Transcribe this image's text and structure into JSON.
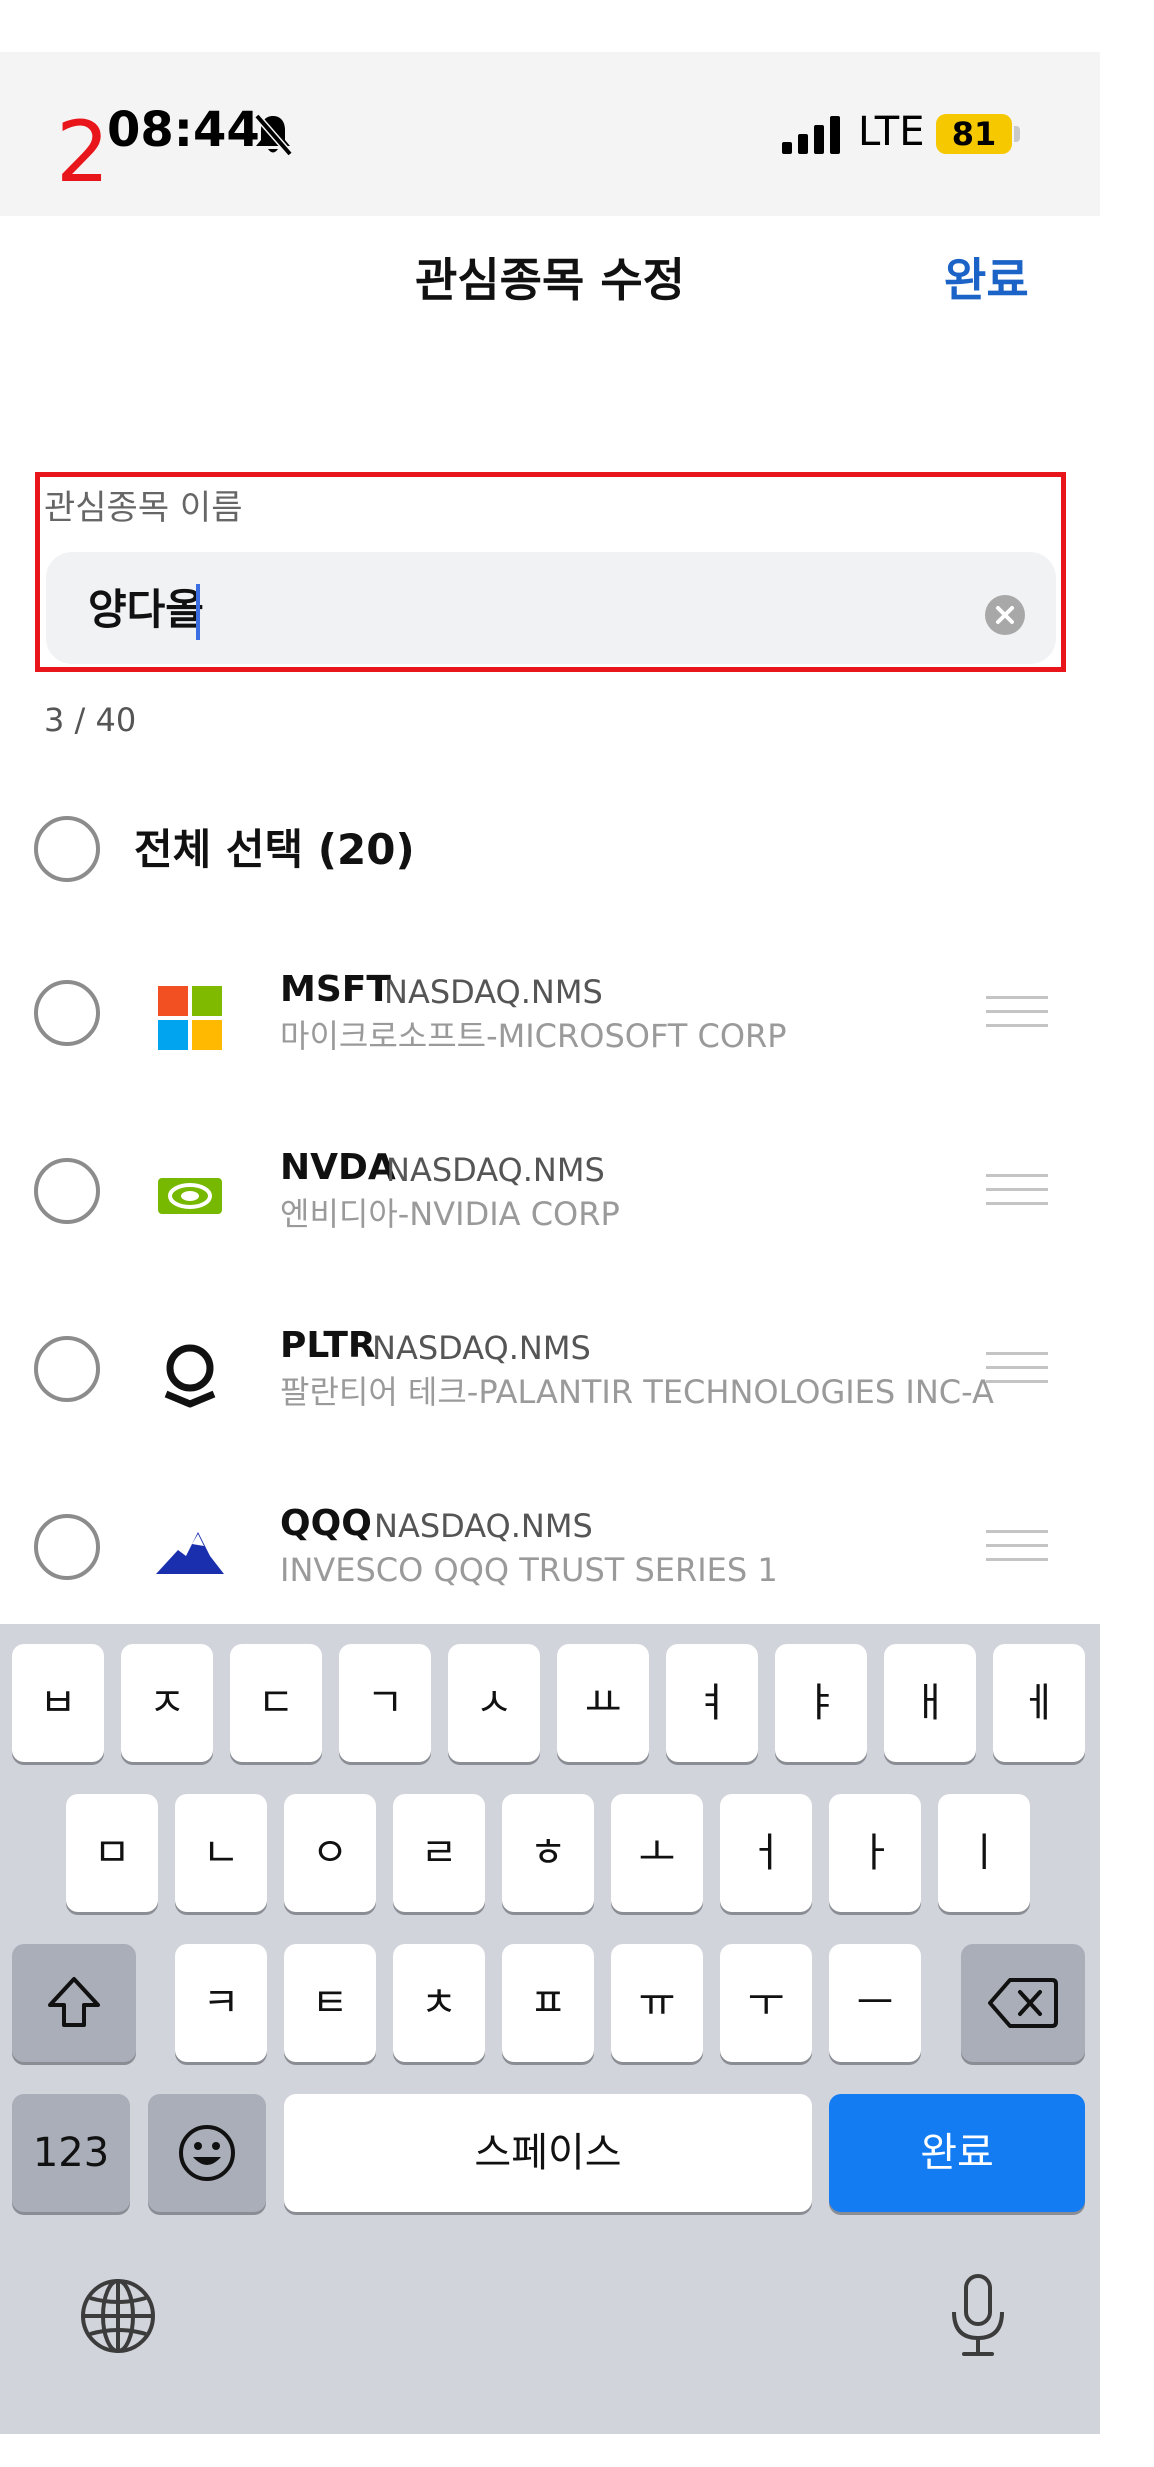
{
  "status_bar": {
    "step_marker": "2",
    "time": "08:44",
    "network": "LTE",
    "battery": "81"
  },
  "header": {
    "title": "관심종목 수정",
    "done": "완료"
  },
  "name_field": {
    "label": "관심종목 이름",
    "value": "양다올",
    "char_count": "3 / 40"
  },
  "select_all": {
    "label": "전체 선택 (20)"
  },
  "stocks": [
    {
      "ticker": "MSFT",
      "exchange": "NASDAQ.NMS",
      "company": "마이크로소프트-MICROSOFT CORP",
      "icon": "microsoft-logo-icon"
    },
    {
      "ticker": "NVDA",
      "exchange": "NASDAQ.NMS",
      "company": "엔비디아-NVIDIA CORP",
      "icon": "nvidia-logo-icon"
    },
    {
      "ticker": "PLTR",
      "exchange": "NASDAQ.NMS",
      "company": "팔란티어 테크-PALANTIR TECHNOLOGIES INC-A",
      "icon": "palantir-logo-icon"
    },
    {
      "ticker": "QQQ",
      "exchange": "NASDAQ.NMS",
      "company": "INVESCO QQQ TRUST SERIES 1",
      "icon": "invesco-logo-icon"
    }
  ],
  "keyboard": {
    "row1": [
      "ㅂ",
      "ㅈ",
      "ㄷ",
      "ㄱ",
      "ㅅ",
      "ㅛ",
      "ㅕ",
      "ㅑ",
      "ㅐ",
      "ㅔ"
    ],
    "row2": [
      "ㅁ",
      "ㄴ",
      "ㅇ",
      "ㄹ",
      "ㅎ",
      "ㅗ",
      "ㅓ",
      "ㅏ",
      "ㅣ"
    ],
    "row3": [
      "ㅋ",
      "ㅌ",
      "ㅊ",
      "ㅍ",
      "ㅠ",
      "ㅜ",
      "ㅡ"
    ],
    "numbers_key": "123",
    "space_key": "스페이스",
    "done_key": "완료"
  },
  "colors": {
    "accent": "#1b63c6",
    "annotation": "#e8161b",
    "keyboard_done": "#137cf3",
    "battery": "#f5c800"
  }
}
